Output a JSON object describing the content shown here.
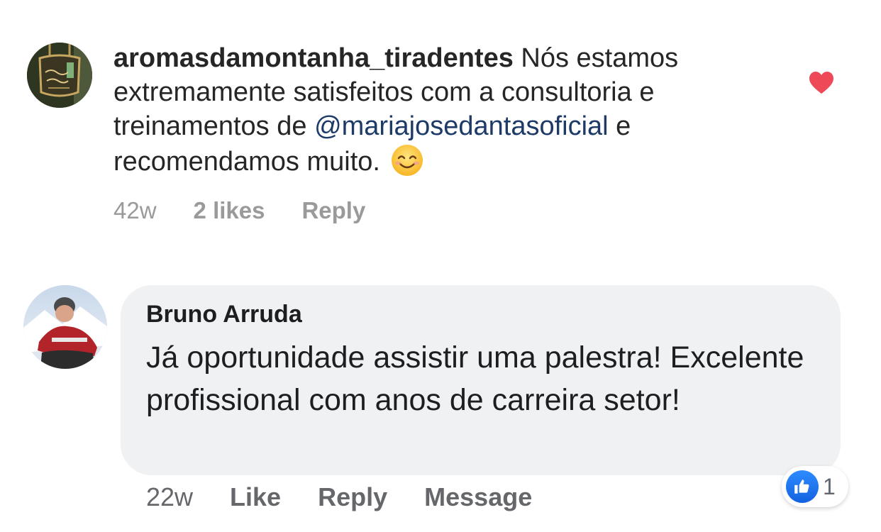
{
  "instagram_comment": {
    "username": "aromasdamontanha_tiradentes",
    "text_before_mention": " Nós estamos extremamente satisfeitos com a consultoria e treinamentos de ",
    "mention": "@mariajosedantasoficial",
    "text_after_mention": " e recomendamos muito.",
    "emoji_icon": "smiling-face-emoji",
    "liked_icon": "heart-icon",
    "heart_color": "#ed4956",
    "mention_color": "#1e3a67",
    "meta": {
      "time": "42w",
      "likes": "2 likes",
      "reply": "Reply"
    }
  },
  "facebook_comment": {
    "author": "Bruno Arruda",
    "text": "Já oportunidade assistir uma palestra! Excelente profissional com anos de carreira setor!",
    "reaction_icon": "like-thumb-icon",
    "reaction_count": "1",
    "like_color": "#1877f2",
    "meta": {
      "time": "22w",
      "like": "Like",
      "reply": "Reply",
      "message": "Message"
    }
  }
}
